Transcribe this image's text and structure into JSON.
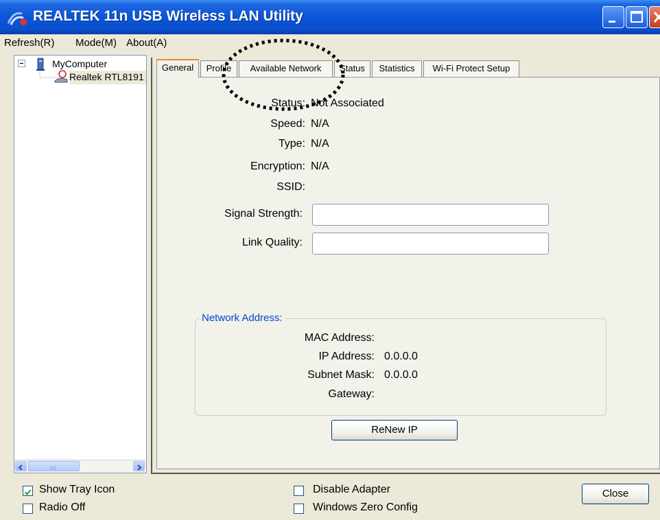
{
  "window": {
    "title": "REALTEK 11n USB Wireless LAN Utility"
  },
  "menu": {
    "items": [
      {
        "label": "Refresh(R)"
      },
      {
        "label": "Mode(M)"
      },
      {
        "label": "About(A)"
      }
    ]
  },
  "tree": {
    "root": "MyComputer",
    "child": "Realtek RTL8191"
  },
  "tabs": [
    {
      "label": "General"
    },
    {
      "label": "Profile"
    },
    {
      "label": "Available Network"
    },
    {
      "label": "Status"
    },
    {
      "label": "Statistics"
    },
    {
      "label": "Wi-Fi Protect Setup"
    }
  ],
  "general": {
    "status_label": "Status:",
    "status_value": "Not Associated",
    "speed_label": "Speed:",
    "speed_value": "N/A",
    "type_label": "Type:",
    "type_value": "N/A",
    "encryption_label": "Encryption:",
    "encryption_value": "N/A",
    "ssid_label": "SSID:",
    "signal_label": "Signal Strength:",
    "link_label": "Link Quality:"
  },
  "network_address": {
    "title": "Network Address:",
    "mac_label": "MAC Address:",
    "ip_label": "IP Address:",
    "ip_value": "0.0.0.0",
    "subnet_label": "Subnet Mask:",
    "subnet_value": "0.0.0.0",
    "gateway_label": "Gateway:"
  },
  "buttons": {
    "renew": "ReNew IP",
    "close": "Close"
  },
  "options": {
    "show_tray": {
      "label": "Show Tray Icon",
      "checked": true
    },
    "radio_off": {
      "label": "Radio Off",
      "checked": false
    },
    "disable_adapter": {
      "label": "Disable Adapter",
      "checked": false
    },
    "windows_zero": {
      "label": "Windows Zero Config",
      "checked": false
    }
  }
}
